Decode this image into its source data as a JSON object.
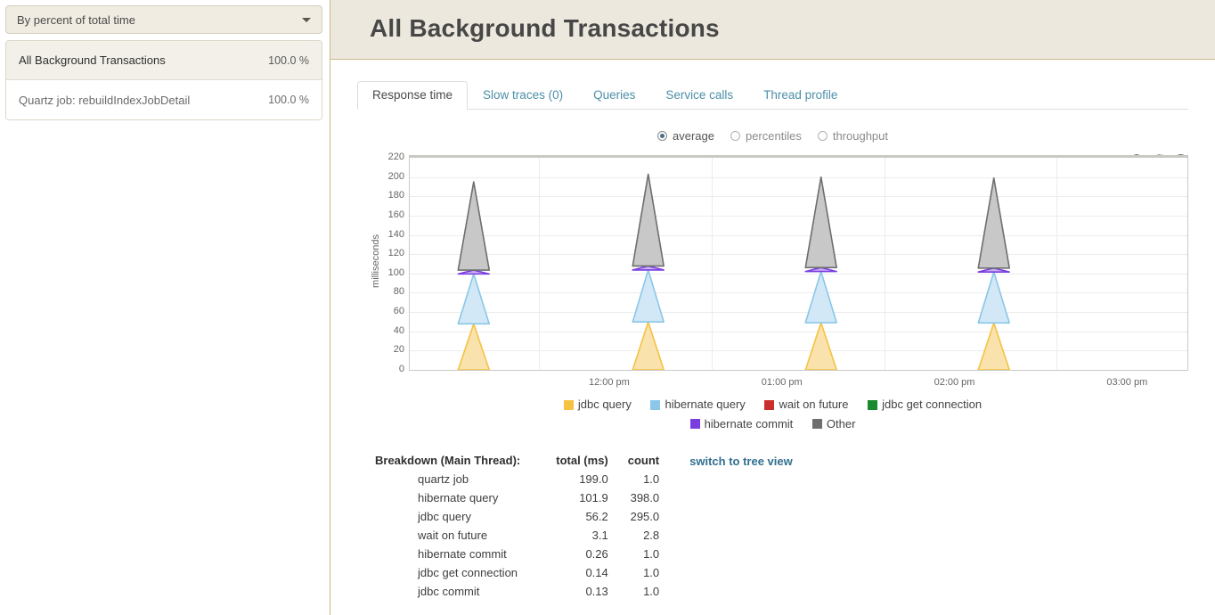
{
  "sidebar": {
    "sort_select": {
      "value": "By percent of total time",
      "icon": "chevron-down-icon"
    },
    "items": [
      {
        "name": "All Background Transactions",
        "percent": "100.0 %",
        "selected": true
      },
      {
        "name": "Quartz job: rebuildIndexJobDetail",
        "percent": "100.0 %",
        "selected": false
      }
    ]
  },
  "header": {
    "title": "All Background Transactions"
  },
  "tabs": [
    {
      "label": "Response time",
      "active": true
    },
    {
      "label": "Slow traces (0)",
      "active": false
    },
    {
      "label": "Queries",
      "active": false
    },
    {
      "label": "Service calls",
      "active": false
    },
    {
      "label": "Thread profile",
      "active": false
    }
  ],
  "metric_options": [
    {
      "label": "average",
      "selected": true
    },
    {
      "label": "percentiles",
      "selected": false
    },
    {
      "label": "throughput",
      "selected": false
    }
  ],
  "chart_tools": [
    {
      "name": "zoom-out-icon",
      "title": "zoom out"
    },
    {
      "name": "refresh-icon",
      "title": "refresh"
    },
    {
      "name": "help-icon",
      "title": "help"
    }
  ],
  "chart_data": {
    "type": "area",
    "stacked": true,
    "title": "",
    "xlabel": "",
    "ylabel": "milliseconds",
    "ylim": [
      0,
      220
    ],
    "yticks": [
      220,
      200,
      180,
      160,
      140,
      120,
      100,
      80,
      60,
      40,
      20,
      0
    ],
    "grid": true,
    "legend_position": "bottom",
    "x_tick_labels": [
      "12:00 pm",
      "01:00 pm",
      "02:00 pm",
      "03:00 pm"
    ],
    "x_tick_positions": [
      0.166,
      0.388,
      0.61,
      0.832
    ],
    "x_domain_hours": [
      11.25,
      15.75
    ],
    "spike_centers_hours": [
      11.62,
      12.63,
      13.63,
      14.63
    ],
    "spike_half_width_hours": 0.09,
    "series": [
      {
        "name": "jdbc query",
        "color": "#f5c242",
        "fill": "#fae2ad",
        "peak": 48
      },
      {
        "name": "hibernate query",
        "color": "#8ac7e8",
        "fill": "#d2e8f7",
        "peak": 100
      },
      {
        "name": "wait on future",
        "color": "#c9302c",
        "fill": "#e8b4b2",
        "peak": 0
      },
      {
        "name": "jdbc get connection",
        "color": "#1a8a2e",
        "fill": "#b6dcbd",
        "peak": 0
      },
      {
        "name": "hibernate commit",
        "color": "#7a3ee0",
        "fill": "#c9b0f2",
        "peak": 104
      },
      {
        "name": "Other",
        "color": "#6e6e6e",
        "fill": "#c8c8c8",
        "peak": 196
      }
    ],
    "spike_peaks_total": [
      195,
      203,
      200,
      199
    ]
  },
  "breakdown": {
    "header_label": "Breakdown (Main Thread):",
    "columns": [
      "total (ms)",
      "count"
    ],
    "rows": [
      {
        "name": "quartz job",
        "total": "199.0",
        "count": "1.0"
      },
      {
        "name": "hibernate query",
        "total": "101.9",
        "count": "398.0"
      },
      {
        "name": "jdbc query",
        "total": "56.2",
        "count": "295.0"
      },
      {
        "name": "wait on future",
        "total": "3.1",
        "count": "2.8"
      },
      {
        "name": "hibernate commit",
        "total": "0.26",
        "count": "1.0"
      },
      {
        "name": "jdbc get connection",
        "total": "0.14",
        "count": "1.0"
      },
      {
        "name": "jdbc commit",
        "total": "0.13",
        "count": "1.0"
      }
    ],
    "tree_view_link": "switch to tree view"
  },
  "colors": {
    "header_bg": "#ece8dd",
    "panel_border": "#cbb88a",
    "link": "#31708f",
    "tab_link": "#4d8fa8"
  }
}
